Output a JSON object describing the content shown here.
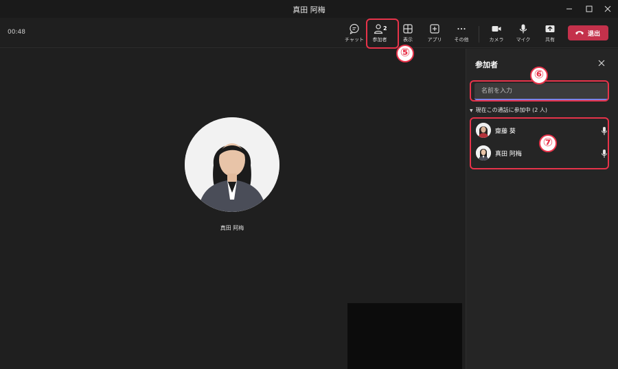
{
  "window": {
    "title": "真田 阿梅"
  },
  "toolbar": {
    "timer": "00:48",
    "chat_label": "チャット",
    "participants_label": "参加者",
    "participants_count": "2",
    "view_label": "表示",
    "apps_label": "アプリ",
    "more_label": "その他",
    "camera_label": "カメラ",
    "mic_label": "マイク",
    "share_label": "共有",
    "leave_label": "退出"
  },
  "stage": {
    "name": "真田 阿梅"
  },
  "panel": {
    "title": "参加者",
    "search_placeholder": "名前を入力",
    "section_label": "現在この通話に参加中 (2 人)",
    "participants": [
      {
        "name": "齋藤 葵"
      },
      {
        "name": "真田 阿梅"
      }
    ]
  },
  "annotations": {
    "badge5": "⑤",
    "badge6": "⑥",
    "badge7": "⑦"
  },
  "colors": {
    "accent": "#7b83eb",
    "leave": "#c4314b",
    "callout": "#e8334a"
  }
}
